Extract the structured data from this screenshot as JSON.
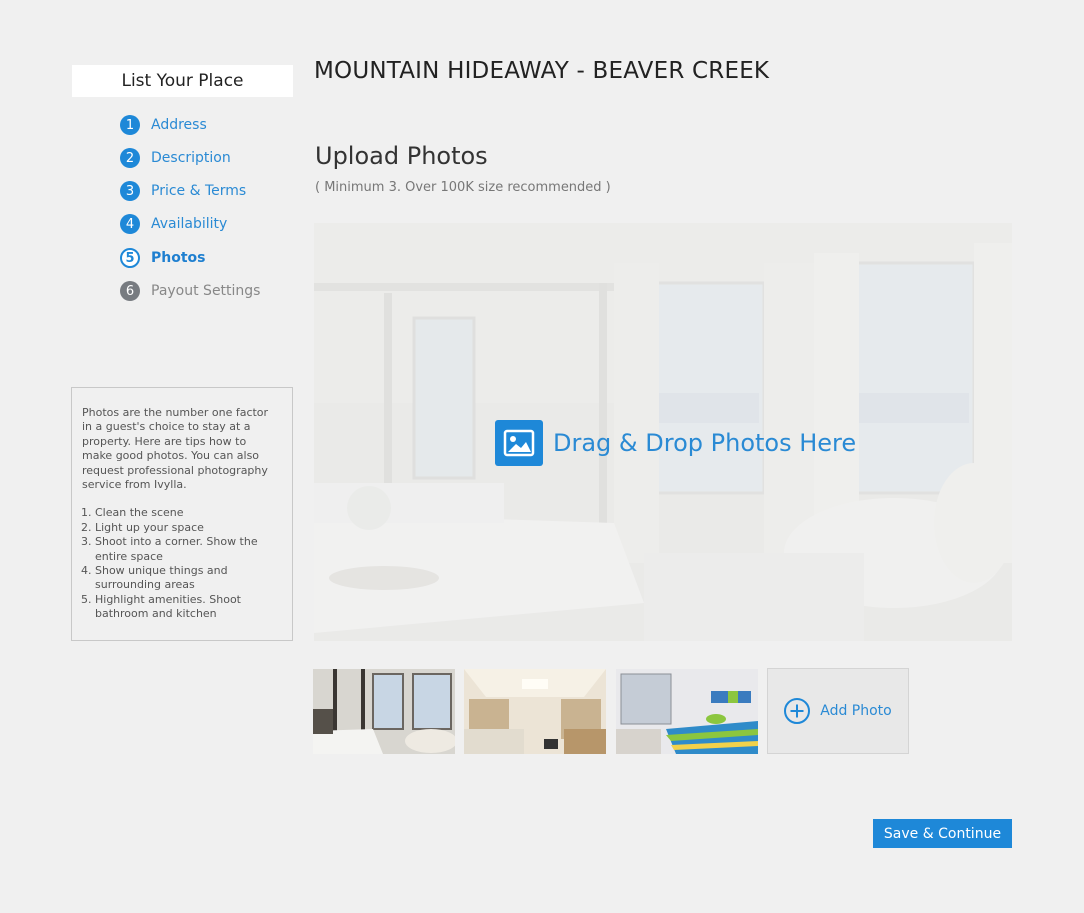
{
  "sidebar": {
    "title": "List Your Place",
    "steps": [
      {
        "number": "1",
        "label": "Address",
        "state": "completed"
      },
      {
        "number": "2",
        "label": "Description",
        "state": "completed"
      },
      {
        "number": "3",
        "label": "Price & Terms",
        "state": "completed"
      },
      {
        "number": "4",
        "label": "Availability",
        "state": "completed"
      },
      {
        "number": "5",
        "label": "Photos",
        "state": "current"
      },
      {
        "number": "6",
        "label": "Payout Settings",
        "state": "disabled"
      }
    ],
    "tips": {
      "intro": "Photos are the number one factor in a guest's choice to stay at a property. Here are tips how to make good photos. You can also request professional photography service from Ivylla.",
      "items": [
        "Clean the scene",
        "Light up your space",
        "Shoot into a corner. Show the entire space",
        "Show unique things and surrounding areas",
        "Highlight amenities. Shoot bathroom and kitchen"
      ]
    }
  },
  "main": {
    "listing_title": "MOUNTAIN HIDEAWAY - BEAVER CREEK",
    "upload_heading": "Upload Photos",
    "upload_note": "( Minimum 3.  Over 100K size recommended )",
    "dropzone_text": "Drag & Drop Photos Here",
    "add_photo_label": "Add Photo",
    "save_button": "Save & Continue"
  },
  "colors": {
    "accent": "#1e88d8",
    "disabled": "#777b80",
    "background": "#f0f0f0"
  }
}
